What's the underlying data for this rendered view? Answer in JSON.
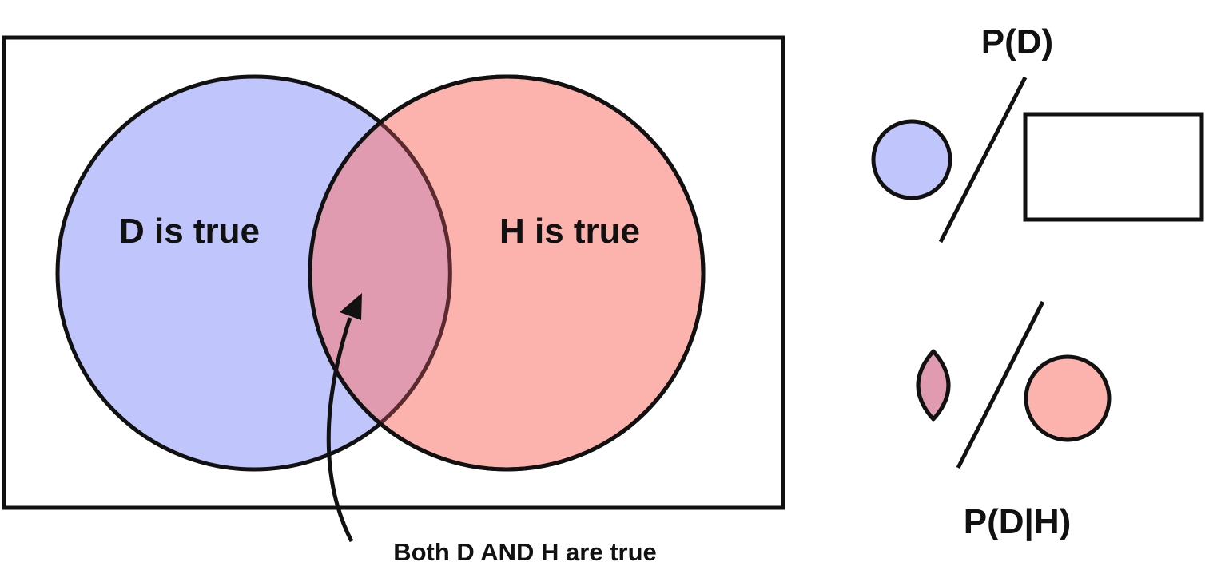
{
  "venn": {
    "d_label": "D is true",
    "h_label": "H is true",
    "both_label": "Both D AND H are true"
  },
  "formulas": {
    "p_d": "P(D)",
    "p_d_given_h": "P(D|H)"
  },
  "colors": {
    "d_fill": "#c0c6fb",
    "h_fill": "#fdb3ad",
    "overlap_fill": "#e09bb0",
    "stroke": "#111111",
    "background": "#ffffff"
  }
}
